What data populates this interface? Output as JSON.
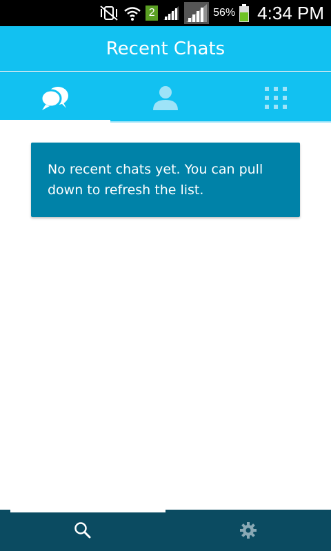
{
  "status_bar": {
    "sim_number": "2",
    "battery": "56%",
    "time": "4:34 PM"
  },
  "app_bar": {
    "title": "Recent Chats"
  },
  "tabs": [
    {
      "icon": "chat-bubbles-icon",
      "selected": true
    },
    {
      "icon": "contact-person-icon",
      "selected": false
    },
    {
      "icon": "grid-dots-icon",
      "selected": false
    }
  ],
  "main": {
    "empty_message": "No recent chats yet. You can pull down to refresh the list."
  },
  "bottom_bar": {
    "items": [
      {
        "icon": "search-icon",
        "selected": true
      },
      {
        "icon": "gear-icon",
        "selected": false
      }
    ]
  },
  "colors": {
    "accent": "#12c1f1",
    "card": "#0082a8",
    "bottom_bar": "#0b4b61",
    "battery": "#6fc224"
  }
}
